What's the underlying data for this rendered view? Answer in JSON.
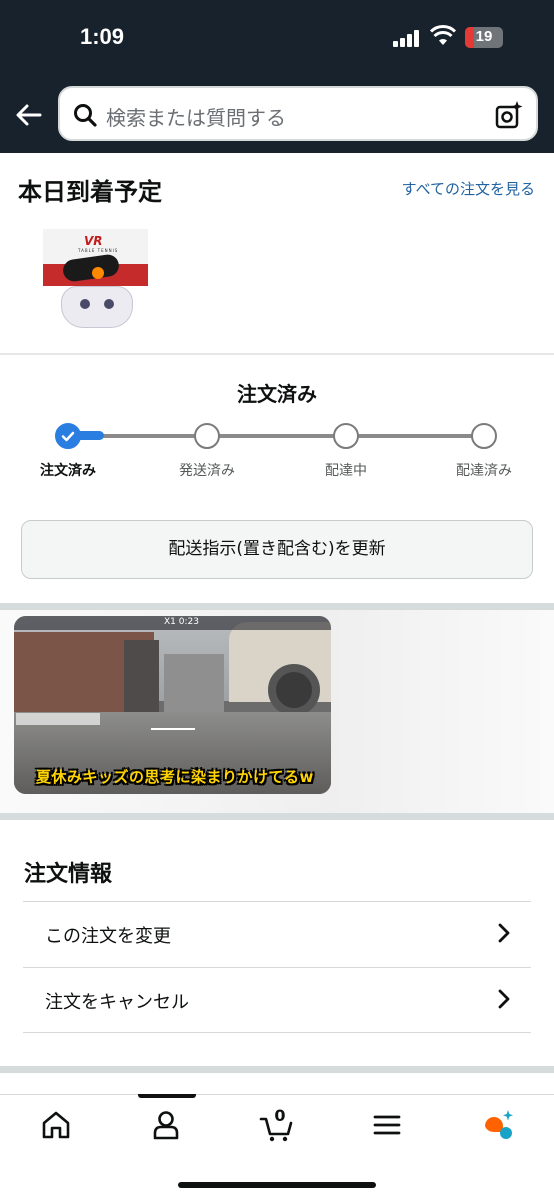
{
  "status_bar": {
    "time": "1:09",
    "battery": "19"
  },
  "search": {
    "placeholder": "検索または質問する"
  },
  "arriving": {
    "title": "本日到着予定",
    "view_all": "すべての注文を見る",
    "product": {
      "logo": "VR",
      "subtitle": "TABLE TENNIS"
    }
  },
  "order_status": {
    "title": "注文済み",
    "current_step": 0,
    "steps": [
      "注文済み",
      "発送済み",
      "配達中",
      "配達済み"
    ]
  },
  "update_button": "配送指示(置き配含む)を更新",
  "video": {
    "caption": "夏休みキッズの思考に染まりかけてるw",
    "hud_text": "X1  0:23"
  },
  "order_info": {
    "title": "注文情報",
    "rows": [
      "この注文を変更",
      "注文をキャンセル"
    ]
  },
  "bottom_nav": {
    "items": [
      "home-icon",
      "account-icon",
      "cart-icon",
      "menu-icon",
      "rufus-assistant-icon"
    ],
    "cart_count": "0"
  },
  "colors": {
    "header_bg": "#18222d",
    "link": "#2162a1",
    "progress": "#2a7de1",
    "caption": "#ffd400"
  }
}
